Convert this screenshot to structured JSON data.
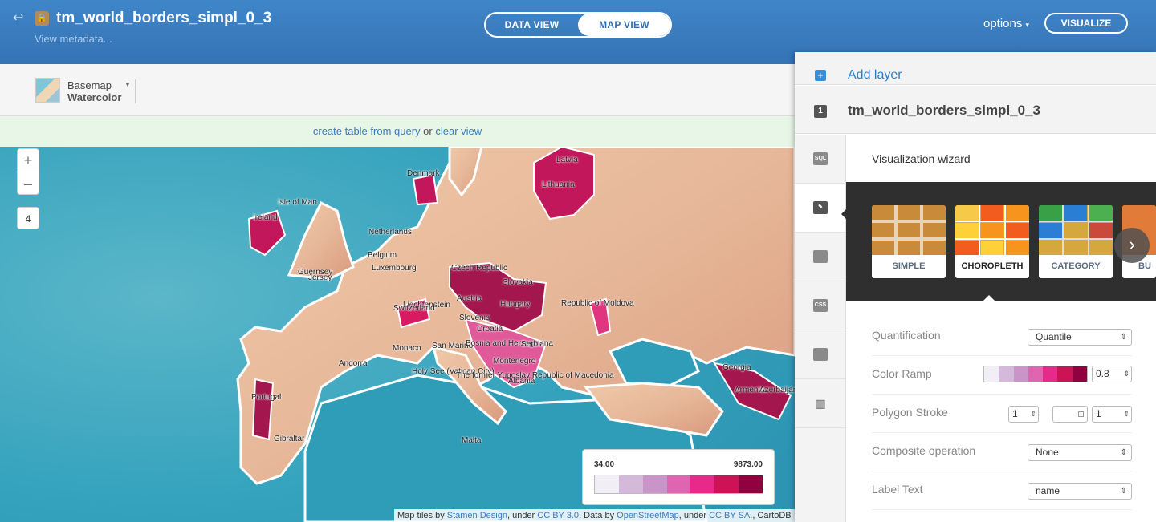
{
  "header": {
    "title": "tm_world_borders_simpl_0_3",
    "metadata_link": "View metadata...",
    "view_toggle": [
      "DATA VIEW",
      "MAP VIEW"
    ],
    "active_view": "MAP VIEW",
    "options_label": "options",
    "visualize_label": "VISUALIZE",
    "lock_icon": "lock-icon",
    "back_icon": "back-arrow-icon"
  },
  "toolbar": {
    "basemap_label": "Basemap",
    "basemap_value": "Watercolor"
  },
  "querybar": {
    "link1": "create table from query",
    "or": " or ",
    "link2": "clear view"
  },
  "map": {
    "zoom_in": "+",
    "zoom_out": "–",
    "zoom_level": "4",
    "labels": [
      "Latvia",
      "Denmark",
      "Lithuania",
      "Isle of Man",
      "Ireland",
      "Netherlands",
      "Belgium",
      "Guernsey",
      "Jersey",
      "Luxembourg",
      "Czech Republic",
      "Slovakia",
      "Liechtenstein",
      "Austria",
      "Hungary",
      "Switzerland",
      "Slovenia",
      "Croatia",
      "Republic of Moldova",
      "Monaco",
      "San Marino",
      "Bosnia and Herzegovina",
      "Serbia",
      "Montenegro",
      "Andorra",
      "Holy See (Vatican City)",
      "The former Yugoslav Republic of Macedonia",
      "Albania",
      "Georgia",
      "Armenia",
      "Azerbaijan",
      "Portugal",
      "Gibraltar",
      "Malta"
    ],
    "legend": {
      "min": "34.00",
      "max": "9873.00",
      "colors": [
        "#f1eef6",
        "#d4b9da",
        "#c994c7",
        "#df65b0",
        "#e7298a",
        "#ce1256",
        "#91003f"
      ]
    },
    "attribution": {
      "prefix": "Map tiles by ",
      "stamen": "Stamen Design",
      "under1": ", under ",
      "ccby": "CC BY 3.0",
      "data": ". Data by ",
      "osm": "OpenStreetMap",
      "under2": ", under ",
      "ccbysa": "CC BY SA",
      "suffix": "., CartoDB"
    }
  },
  "panel": {
    "add_layer": "Add layer",
    "layer_number": "1",
    "layer_name": "tm_world_borders_simpl_0_3",
    "tabs": [
      "sql",
      "wizard",
      "infowindow",
      "css",
      "legend",
      "filters"
    ],
    "tab_texts": {
      "sql": "SQL",
      "css": "CSS"
    },
    "wizard_title": "Visualization wizard",
    "visualizations": [
      "SIMPLE",
      "CHOROPLETH",
      "CATEGORY",
      "BU"
    ],
    "selected_visualization": "CHOROPLETH",
    "rows": {
      "quantification": {
        "label": "Quantification",
        "value": "Quantile"
      },
      "color_ramp": {
        "label": "Color Ramp",
        "opacity": "0.8",
        "colors": [
          "#f1eef6",
          "#d4b9da",
          "#c994c7",
          "#df65b0",
          "#e7298a",
          "#ce1256",
          "#91003f"
        ]
      },
      "polygon_stroke": {
        "label": "Polygon Stroke",
        "width": "1",
        "opacity": "1"
      },
      "composite": {
        "label": "Composite operation",
        "value": "None"
      },
      "label_text": {
        "label": "Label Text",
        "value": "name"
      }
    }
  }
}
